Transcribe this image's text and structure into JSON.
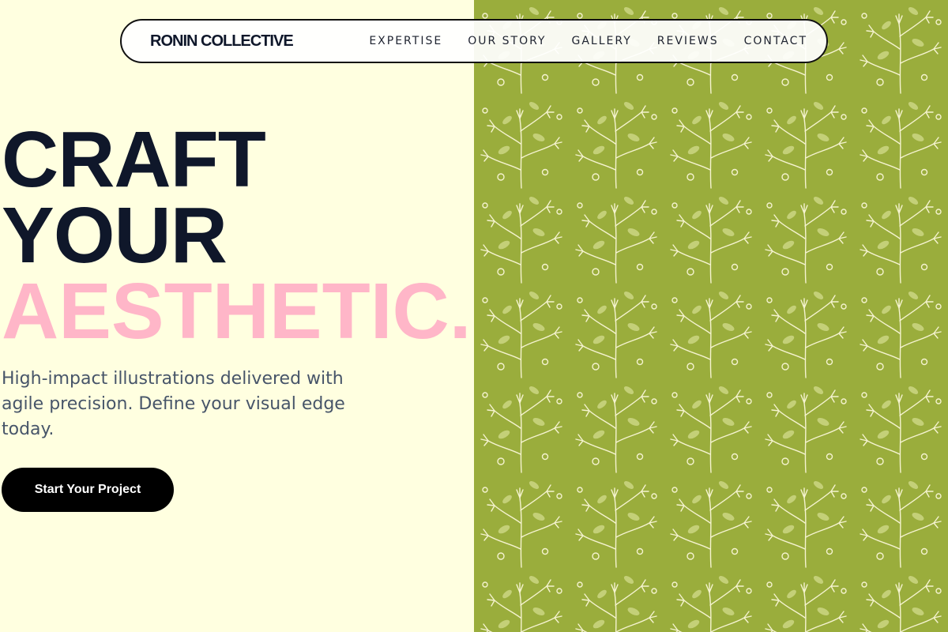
{
  "brand": {
    "name": "RONIN COLLECTIVE"
  },
  "nav": {
    "items": [
      {
        "label": "EXPERTISE"
      },
      {
        "label": "OUR STORY"
      },
      {
        "label": "GALLERY"
      },
      {
        "label": "REVIEWS"
      },
      {
        "label": "CONTACT"
      }
    ]
  },
  "hero": {
    "line1": "CRAFT",
    "line2": "YOUR",
    "line3": "AESTHETIC.",
    "subtitle": "High-impact illustrations delivered with agile precision. Define your visual edge today.",
    "cta_label": "Start Your Project"
  },
  "colors": {
    "background": "#FFFFE0",
    "headline": "#0F172A",
    "accent_pink": "#FFB6C8",
    "subtitle": "#475569",
    "cta_background": "#000000",
    "pattern_green": "#9aad3c",
    "pattern_leaf": "#f5f3cf"
  },
  "icons": {
    "hero_pattern": "fern-leaf-pattern"
  }
}
